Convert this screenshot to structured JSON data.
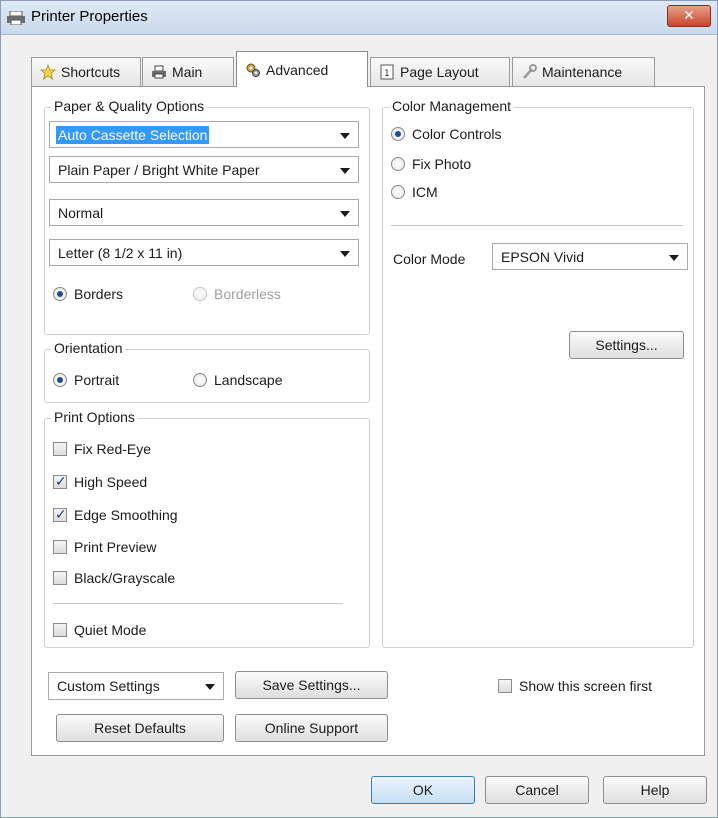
{
  "window": {
    "title": "Printer Properties",
    "close_label": "✕"
  },
  "tabs": [
    {
      "label": "Shortcuts",
      "icon": "star-icon"
    },
    {
      "label": "Main",
      "icon": "printer-icon"
    },
    {
      "label": "Advanced",
      "icon": "gears-icon",
      "active": true
    },
    {
      "label": "Page Layout",
      "icon": "page-icon"
    },
    {
      "label": "Maintenance",
      "icon": "wrench-icon"
    }
  ],
  "paper_quality": {
    "label": "Paper & Quality Options",
    "source": "Auto Cassette Selection",
    "paper_type": "Plain Paper / Bright White Paper",
    "quality": "Normal",
    "size": "Letter (8 1/2 x 11 in)",
    "borders_label": "Borders",
    "borderless_label": "Borderless"
  },
  "orientation": {
    "label": "Orientation",
    "portrait_label": "Portrait",
    "landscape_label": "Landscape"
  },
  "print_options": {
    "label": "Print Options",
    "items": [
      {
        "label": "Fix Red-Eye",
        "checked": false
      },
      {
        "label": "High Speed",
        "checked": true
      },
      {
        "label": "Edge Smoothing",
        "checked": true
      },
      {
        "label": "Print Preview",
        "checked": false
      },
      {
        "label": "Black/Grayscale",
        "checked": false
      }
    ],
    "quiet_mode_label": "Quiet Mode"
  },
  "color_management": {
    "label": "Color Management",
    "color_controls_label": "Color Controls",
    "fix_photo_label": "Fix Photo",
    "icm_label": "ICM",
    "color_mode_label": "Color Mode",
    "color_mode_value": "EPSON Vivid",
    "settings_label": "Settings..."
  },
  "bottom": {
    "custom_settings": "Custom Settings",
    "save_settings_label": "Save Settings...",
    "show_first_label": "Show this screen first",
    "reset_defaults_label": "Reset Defaults",
    "online_support_label": "Online Support"
  },
  "dialog_buttons": {
    "ok_label": "OK",
    "cancel_label": "Cancel",
    "help_label": "Help"
  },
  "colors": {
    "selection": "#3399ff",
    "titlebar": "#c9d9ec",
    "close": "#c9462c"
  }
}
